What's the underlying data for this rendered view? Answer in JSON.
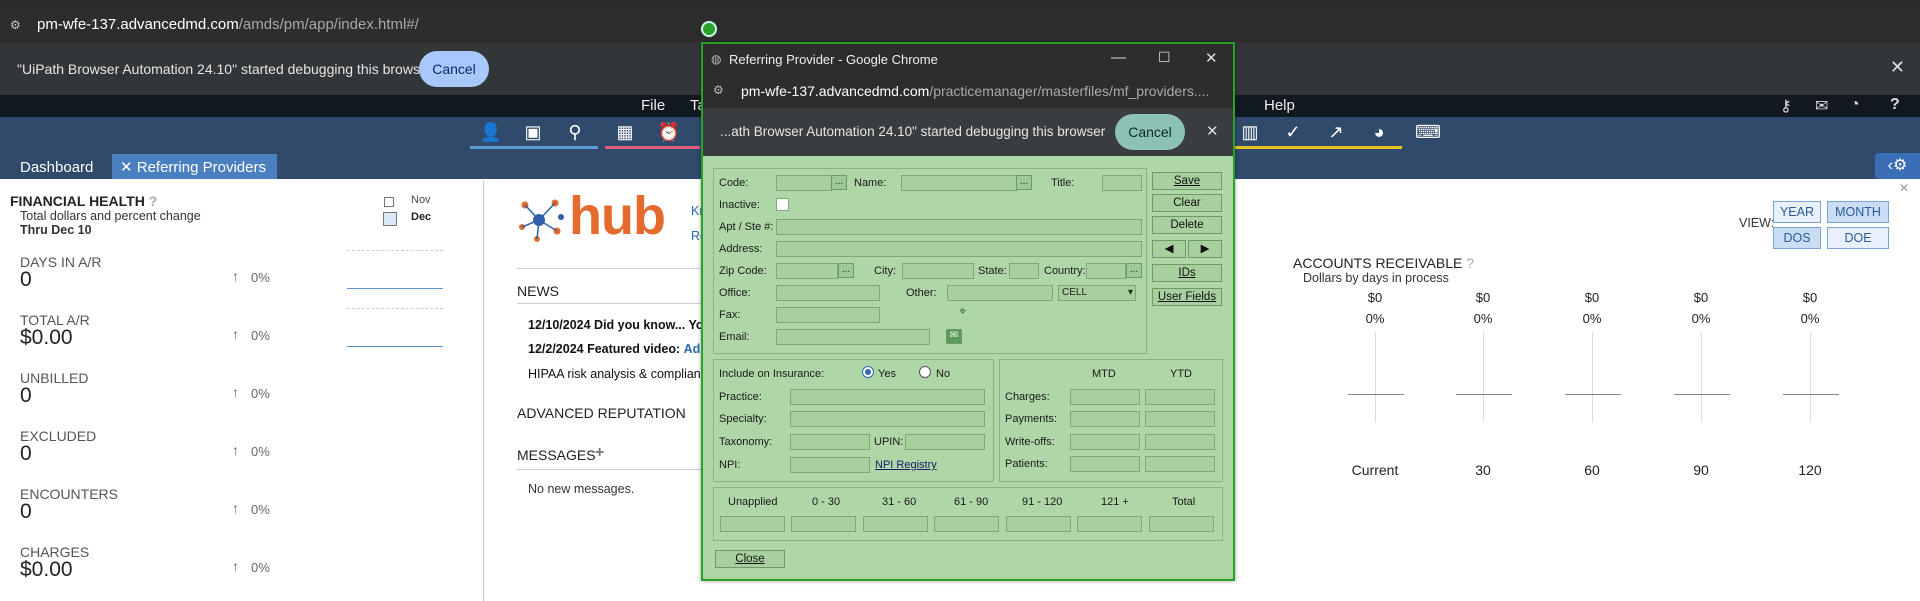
{
  "browser": {
    "url_host": "pm-wfe-137.advancedmd.com",
    "url_path": "/amds/pm/app/index.html#/",
    "debug_message": "\"UiPath Browser Automation 24.10\" started debugging this browser",
    "debug_cancel": "Cancel"
  },
  "menubar": {
    "file": "File",
    "ta": "Ta",
    "help": "Help"
  },
  "tabs": {
    "dashboard": "Dashboard",
    "referring": "Referring Providers"
  },
  "financial_health": {
    "title": "FINANCIAL HEALTH",
    "subtitle": "Total dollars and percent change",
    "thru": "Thru Dec 10",
    "legend_prev": "Nov",
    "legend_curr": "Dec",
    "metrics": [
      {
        "label": "DAYS IN A/R",
        "value": "0",
        "pct": "0%"
      },
      {
        "label": "TOTAL A/R",
        "value": "$0.00",
        "pct": "0%"
      },
      {
        "label": "UNBILLED",
        "value": "0",
        "pct": "0%"
      },
      {
        "label": "EXCLUDED",
        "value": "0",
        "pct": "0%"
      },
      {
        "label": "ENCOUNTERS",
        "value": "0",
        "pct": "0%"
      },
      {
        "label": "CHARGES",
        "value": "$0.00",
        "pct": "0%"
      }
    ]
  },
  "center": {
    "hub_text": "hub",
    "kn": "Kn",
    "re": "Re",
    "news_title": "NEWS",
    "news": [
      {
        "date": "12/10/2024",
        "text": "Did you know... Yo"
      },
      {
        "date": "12/2/2024",
        "text": "Featured video:",
        "link": "Ad"
      },
      {
        "date": "",
        "text": "HIPAA risk analysis & complianc"
      }
    ],
    "reputation_title": "ADVANCED REPUTATION",
    "messages_title": "MESSAGES",
    "messages_empty": "No new messages."
  },
  "ar": {
    "title": "ACCOUNTS RECEIVABLE",
    "subtitle": "Dollars by days in process",
    "view_label": "VIEW:",
    "view_buttons": [
      "YEAR",
      "MONTH",
      "DOS",
      "DOE"
    ],
    "buckets": [
      {
        "label": "Current",
        "amount": "$0",
        "pct": "0%"
      },
      {
        "label": "30",
        "amount": "$0",
        "pct": "0%"
      },
      {
        "label": "60",
        "amount": "$0",
        "pct": "0%"
      },
      {
        "label": "90",
        "amount": "$0",
        "pct": "0%"
      },
      {
        "label": "120",
        "amount": "$0",
        "pct": "0%"
      }
    ]
  },
  "popup": {
    "title": "Referring Provider - Google Chrome",
    "url_host": "pm-wfe-137.advancedmd.com",
    "url_path": "/practicemanager/masterfiles/mf_providers....",
    "debug_message": "...ath Browser Automation 24.10\" started debugging this browser",
    "debug_cancel": "Cancel",
    "form": {
      "code": "Code:",
      "name": "Name:",
      "title": "Title:",
      "inactive": "Inactive:",
      "apt": "Apt / Ste #:",
      "address": "Address:",
      "zip": "Zip Code:",
      "city": "City:",
      "state": "State:",
      "country": "Country:",
      "office": "Office:",
      "other": "Other:",
      "other_type": "CELL",
      "fax": "Fax:",
      "email": "Email:"
    },
    "side_buttons": [
      "Save",
      "Clear",
      "Delete",
      "IDs",
      "User Fields"
    ],
    "insurance": {
      "label": "Include on Insurance:",
      "yes": "Yes",
      "no": "No",
      "practice": "Practice:",
      "specialty": "Specialty:",
      "taxonomy": "Taxonomy:",
      "upin": "UPIN:",
      "npi": "NPI:",
      "npi_registry": "NPI Registry"
    },
    "totals": {
      "mtd": "MTD",
      "ytd": "YTD",
      "rows": [
        "Charges:",
        "Payments:",
        "Write-offs:",
        "Patients:"
      ]
    },
    "aging": [
      "Unapplied",
      "0 - 30",
      "31 - 60",
      "61 - 90",
      "91 - 120",
      "121 +",
      "Total"
    ],
    "close": "Close"
  }
}
